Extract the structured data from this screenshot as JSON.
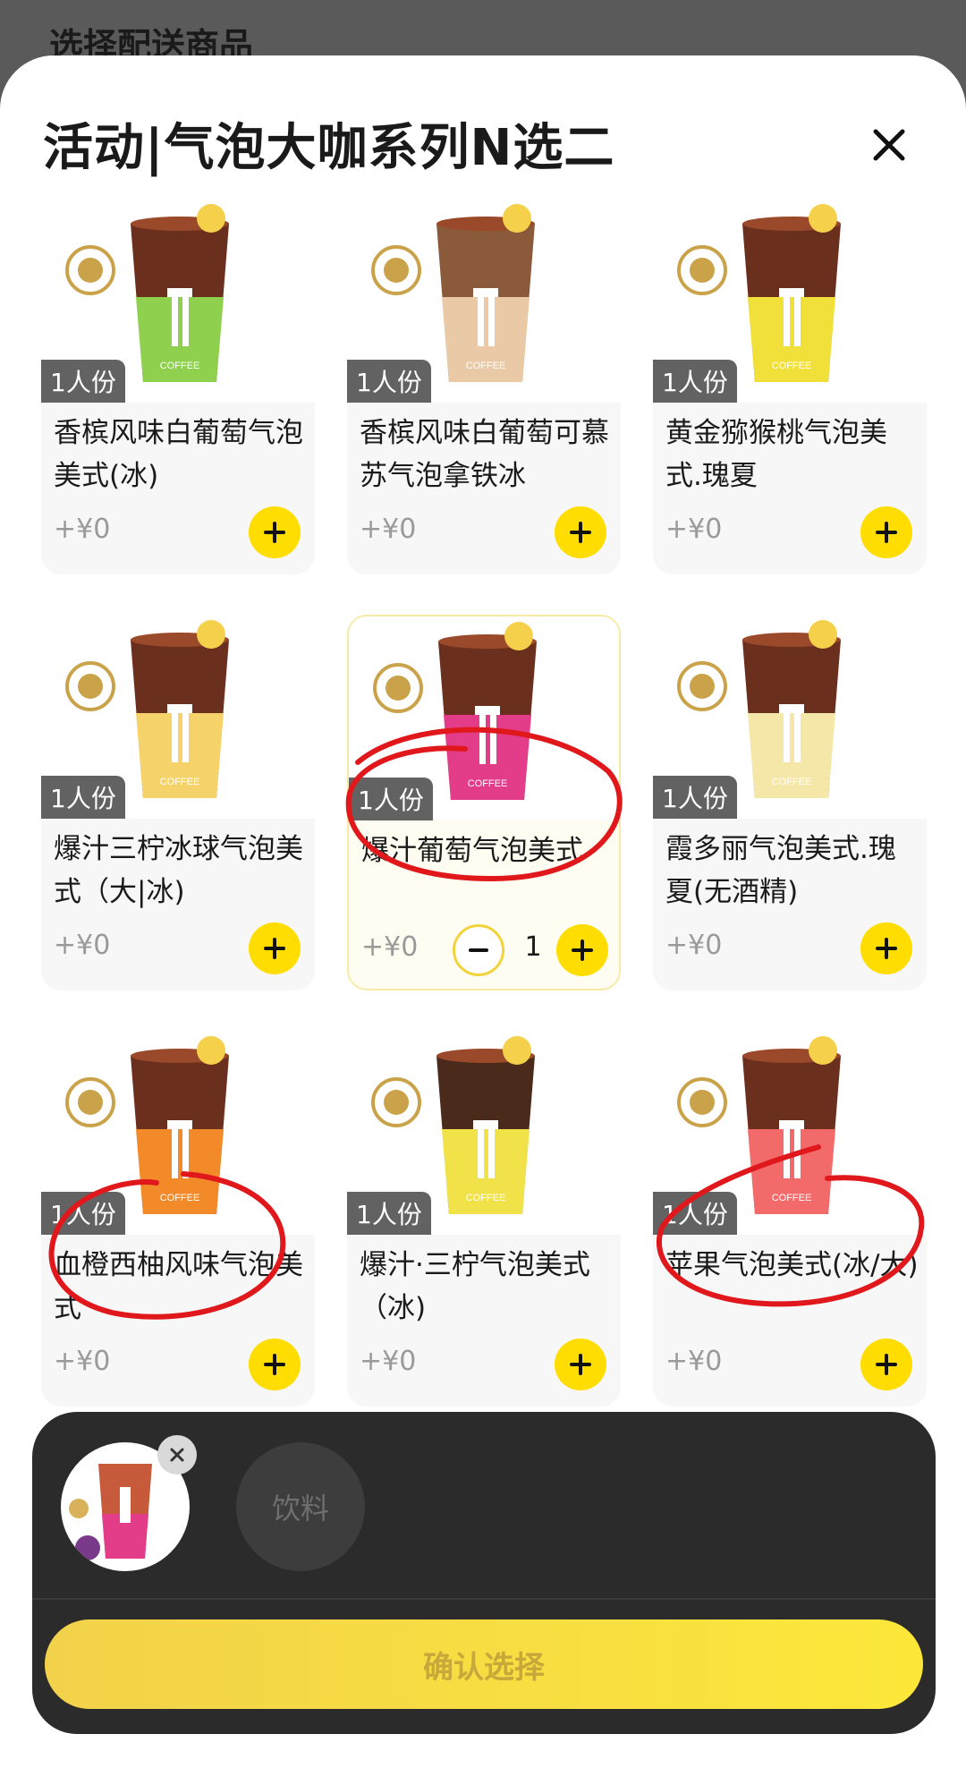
{
  "background_page": {
    "title": "选择配送商品"
  },
  "sheet": {
    "title": "活动|气泡大咖系列N选二",
    "close_icon": "close-icon"
  },
  "products": [
    {
      "badge": "1人份",
      "name": "香槟风味白葡萄气泡美式(冰)",
      "price": "+¥0",
      "image": "coffee-cup-green-icon"
    },
    {
      "badge": "1人份",
      "name": "香槟风味白葡萄可慕苏气泡拿铁冰",
      "price": "+¥0",
      "image": "coffee-cup-latte-icon"
    },
    {
      "badge": "1人份",
      "name": "黄金猕猴桃气泡美式.瑰夏",
      "price": "+¥0",
      "image": "coffee-cup-yellow-icon"
    },
    {
      "badge": "1人份",
      "name": "爆汁三柠冰球气泡美式（大|冰)",
      "price": "+¥0",
      "image": "coffee-cup-iceball-icon"
    },
    {
      "badge": "1人份",
      "name": "爆汁葡萄气泡美式",
      "price": "+¥0",
      "image": "coffee-cup-pink-icon",
      "selected": true,
      "quantity": "1"
    },
    {
      "badge": "1人份",
      "name": "霞多丽气泡美式.瑰夏(无酒精)",
      "price": "+¥0",
      "image": "coffee-cup-light-icon"
    },
    {
      "badge": "1人份",
      "name": "血橙西柚风味气泡美式",
      "price": "+¥0",
      "image": "coffee-cup-orange-icon"
    },
    {
      "badge": "1人份",
      "name": "爆汁·三柠气泡美式（冰)",
      "price": "+¥0",
      "image": "coffee-cup-lemon-icon"
    },
    {
      "badge": "1人份",
      "name": "苹果气泡美式(冰/大)",
      "price": "+¥0",
      "image": "coffee-cup-red-icon"
    }
  ],
  "bottom_bar": {
    "slot_placeholder": "饮料",
    "confirm_label": "确认选择"
  },
  "colors": {
    "accent": "#ffdd00",
    "annotation": "#e0181c",
    "bar": "#2b2b2b"
  }
}
